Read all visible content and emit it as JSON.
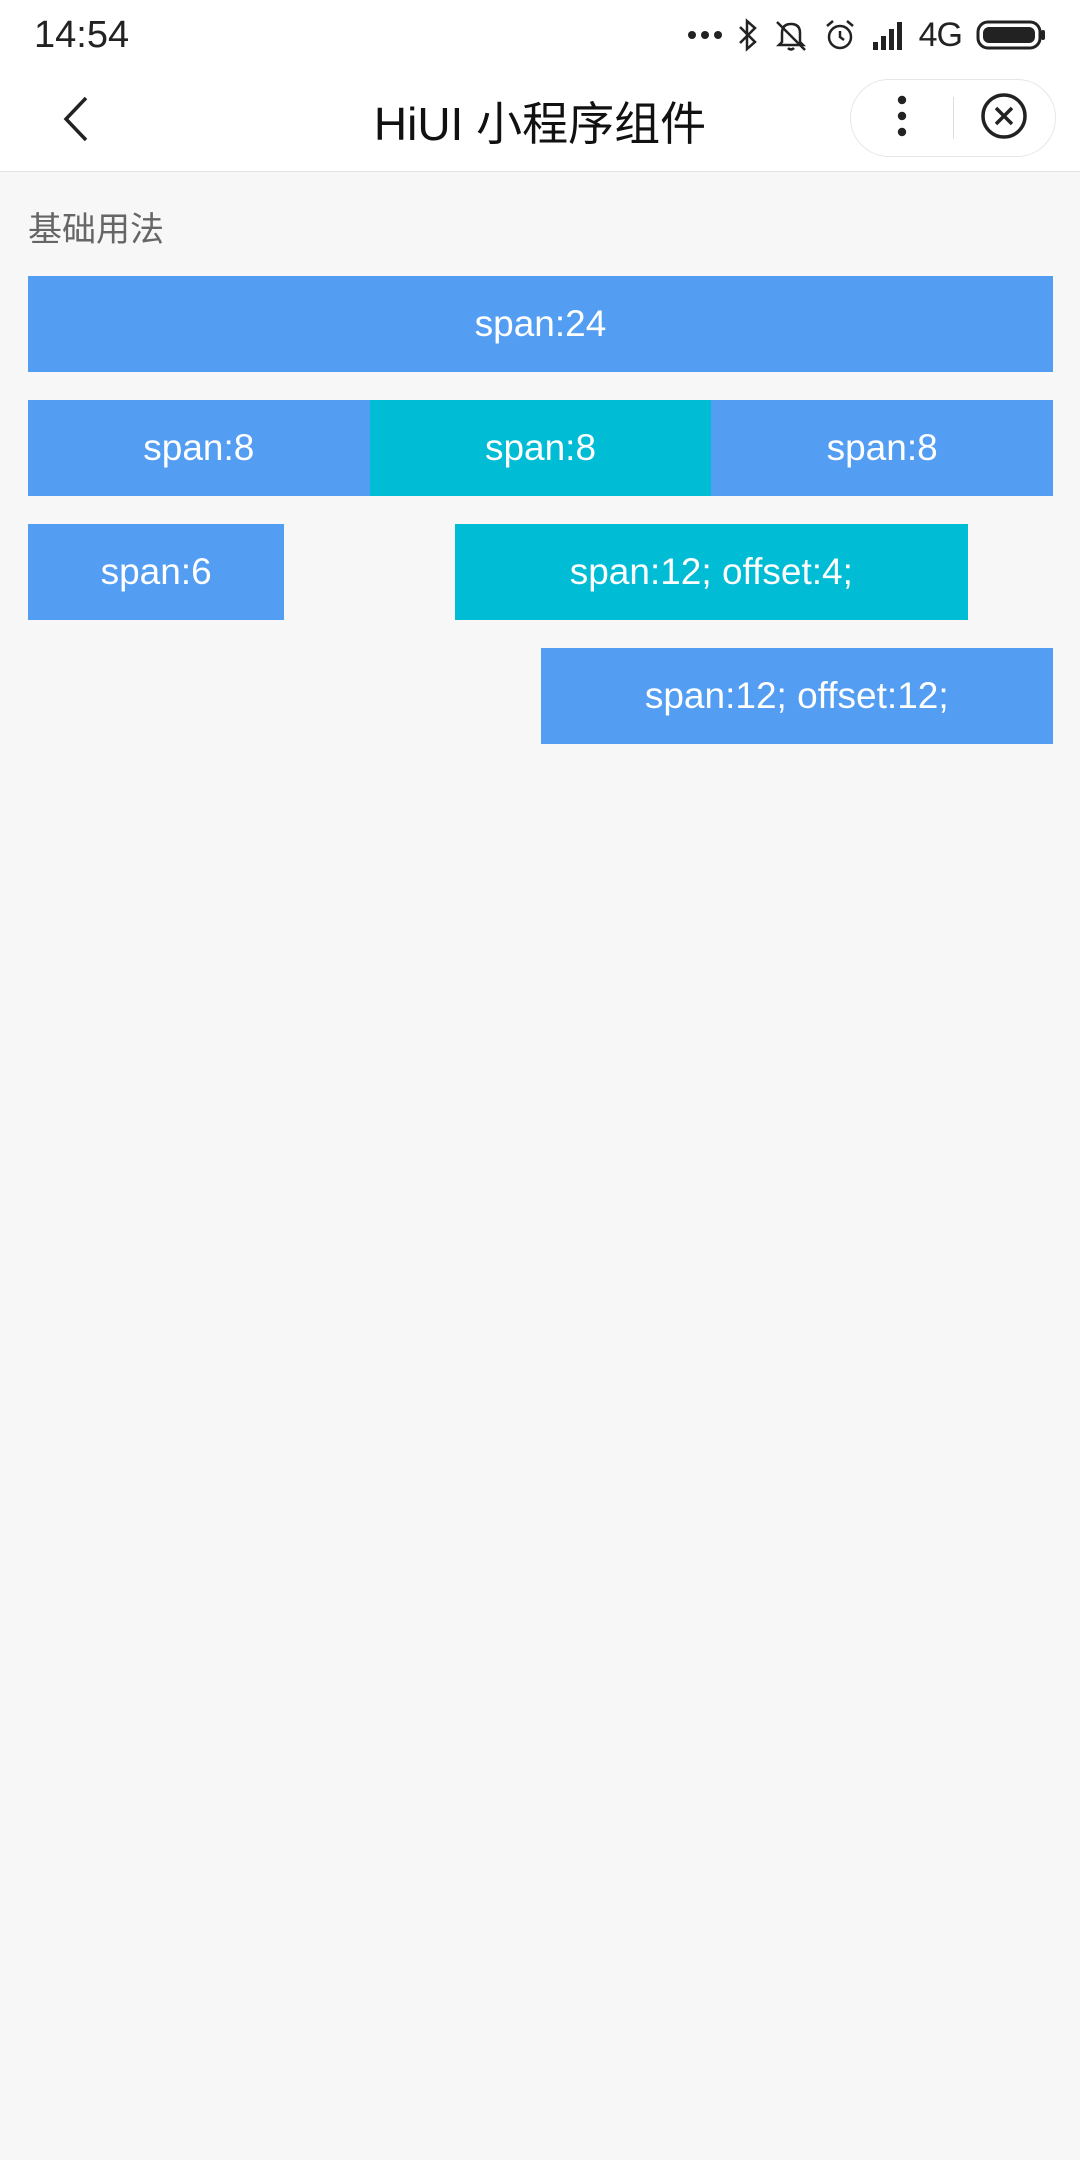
{
  "status_bar": {
    "time": "14:54",
    "network": "4G",
    "icons": [
      "more-dots-icon",
      "bluetooth-icon",
      "mute-icon",
      "alarm-icon",
      "signal-icon",
      "battery-icon"
    ]
  },
  "nav": {
    "title": "HiUI  小程序组件",
    "back_icon": "chevron-left-icon",
    "more_icon": "more-vertical-icon",
    "close_icon": "close-circle-icon"
  },
  "section": {
    "title": "基础用法"
  },
  "colors": {
    "blue": "#539df2",
    "cyan": "#00bcd4"
  },
  "rows": [
    {
      "cols": [
        {
          "label": "span:24",
          "span": 24,
          "offset": 0,
          "color": "blue"
        }
      ]
    },
    {
      "cols": [
        {
          "label": "span:8",
          "span": 8,
          "offset": 0,
          "color": "blue"
        },
        {
          "label": "span:8",
          "span": 8,
          "offset": 0,
          "color": "cyan"
        },
        {
          "label": "span:8",
          "span": 8,
          "offset": 0,
          "color": "blue"
        }
      ]
    },
    {
      "cols": [
        {
          "label": "span:6",
          "span": 6,
          "offset": 0,
          "color": "blue"
        },
        {
          "label": "span:12; offset:4;",
          "span": 12,
          "offset": 4,
          "color": "cyan"
        }
      ]
    },
    {
      "cols": [
        {
          "label": "span:12; offset:12;",
          "span": 12,
          "offset": 12,
          "color": "blue"
        }
      ]
    }
  ]
}
